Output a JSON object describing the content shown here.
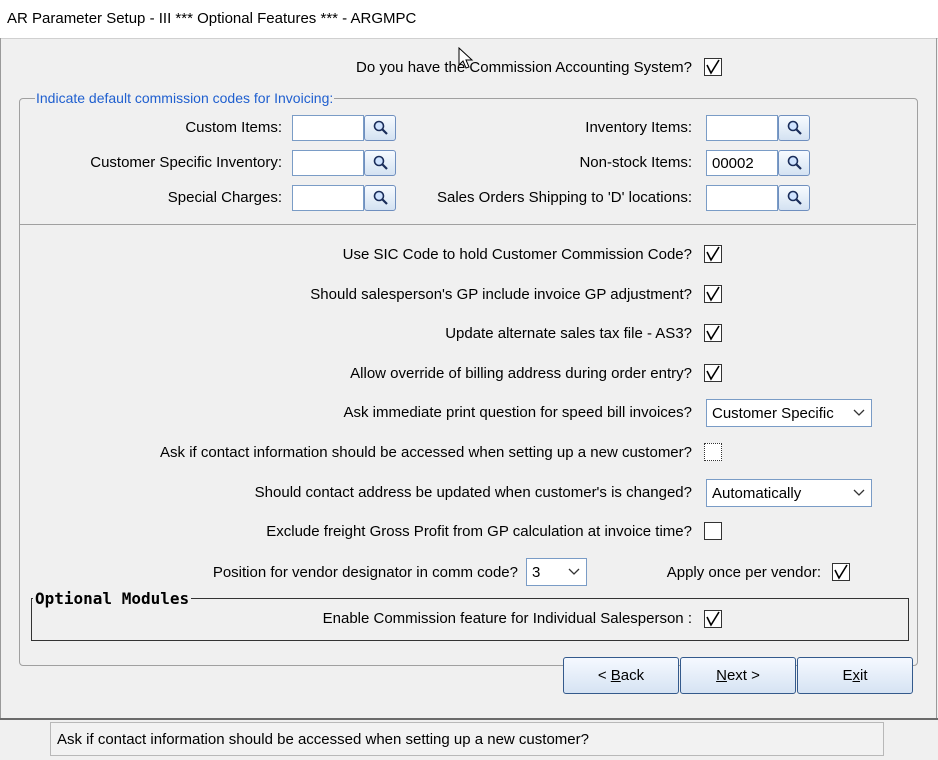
{
  "window": {
    "title": "AR Parameter Setup - III   *** Optional Features *** - ARGMPC"
  },
  "commission_system": {
    "label": "Do you have the Commission Accounting System?",
    "checked": true
  },
  "invoicing_group": {
    "title": "Indicate default commission codes for Invoicing:",
    "fields": {
      "custom_items": {
        "label": "Custom Items:",
        "value": ""
      },
      "customer_specific_inventory": {
        "label": "Customer Specific Inventory:",
        "value": ""
      },
      "special_charges": {
        "label": "Special Charges:",
        "value": ""
      },
      "inventory_items": {
        "label": "Inventory Items:",
        "value": ""
      },
      "non_stock_items": {
        "label": "Non-stock Items:",
        "value": "00002"
      },
      "sales_orders_d_locations": {
        "label": "Sales Orders Shipping to 'D' locations:",
        "value": ""
      }
    }
  },
  "options": {
    "sic_code": {
      "label": "Use SIC Code to hold Customer Commission Code?",
      "checked": true
    },
    "gp_adjustment": {
      "label": "Should salesperson's GP include invoice GP adjustment?",
      "checked": true
    },
    "alt_sales_tax": {
      "label": "Update alternate sales tax file - AS3?",
      "checked": true
    },
    "billing_override": {
      "label": "Allow override of billing address during order entry?",
      "checked": true
    },
    "speed_bill": {
      "label": "Ask immediate print question for speed bill invoices?",
      "selected": "Customer Specific"
    },
    "contact_info": {
      "label": "Ask if contact information should be accessed when setting up a new customer?",
      "checked": false
    },
    "contact_address": {
      "label": "Should contact address be updated when customer's is changed?",
      "selected": "Automatically"
    },
    "exclude_freight": {
      "label": "Exclude freight Gross Profit from GP calculation at invoice time?",
      "checked": false
    },
    "vendor_position": {
      "label": "Position for vendor designator in comm code?",
      "selected": "3"
    },
    "apply_once": {
      "label": "Apply once per vendor:",
      "checked": true
    }
  },
  "optional_modules": {
    "title": "Optional Modules",
    "individual_salesperson": {
      "label": "Enable Commission feature for Individual Salesperson :",
      "checked": true
    }
  },
  "buttons": {
    "back": {
      "pre": "< ",
      "key": "B",
      "post": "ack"
    },
    "next": {
      "pre": "",
      "key": "N",
      "post": "ext >"
    },
    "exit": {
      "pre": "E",
      "key": "x",
      "post": "it"
    }
  },
  "status": {
    "text": "Ask if contact information should be accessed when setting up a new customer?"
  },
  "colors": {
    "group_title": "#1f5fcf",
    "check_mark": "#000000"
  },
  "icons": {
    "lookup": "magnifier-icon",
    "dropdown": "chevron-down-icon",
    "check": "checkmark-icon",
    "cursor": "mouse-pointer-icon"
  }
}
